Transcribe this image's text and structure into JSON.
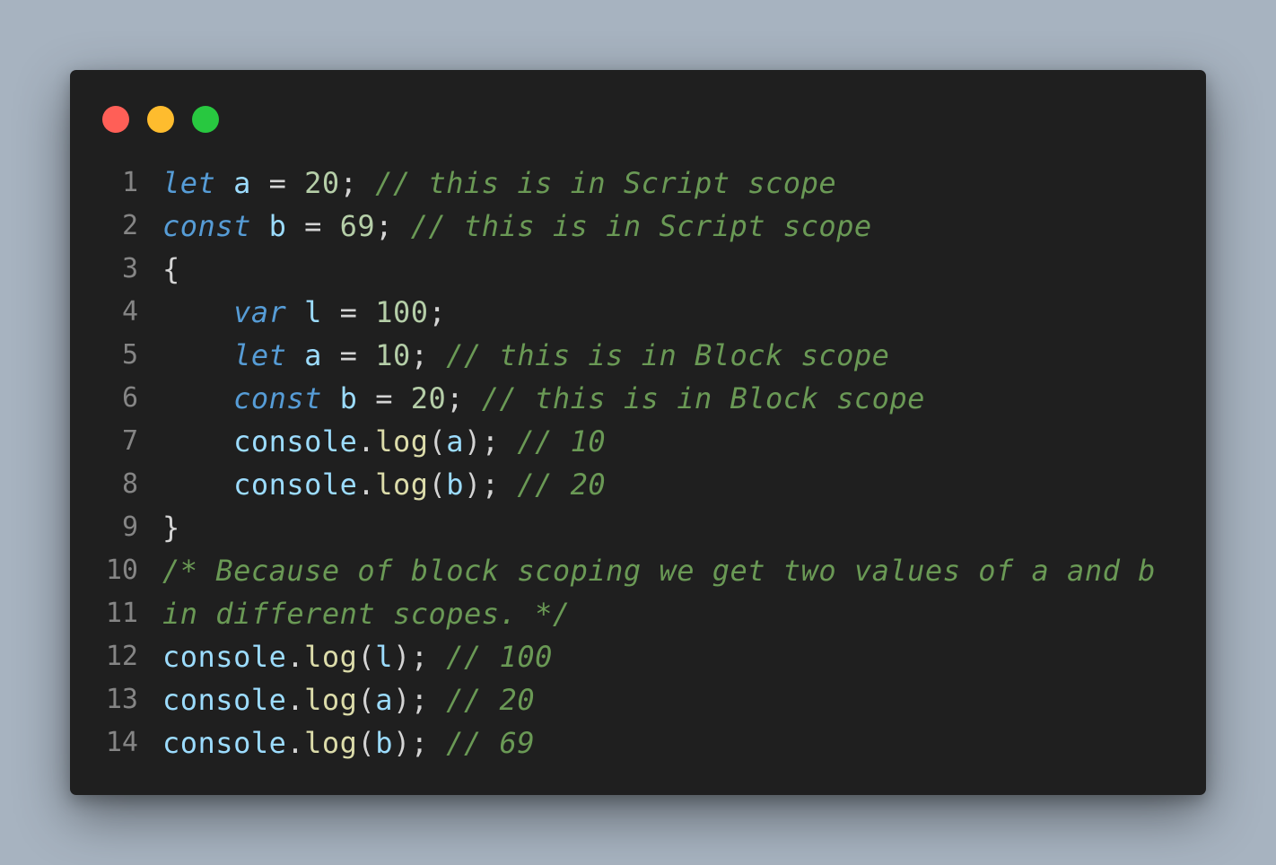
{
  "colors": {
    "page_background": "#a7b3c0",
    "editor_background": "#1f1f1f",
    "close": "#ff5f57",
    "minimize": "#febc2e",
    "maximize": "#28c840",
    "line_number": "#858585",
    "keyword": "#569cd6",
    "variable": "#9cdcfe",
    "number": "#b5cea8",
    "function": "#dcdcaa",
    "comment": "#6a9955",
    "plain": "#d4d4d4"
  },
  "window_controls": [
    {
      "name": "close-button",
      "icon": "red-circle"
    },
    {
      "name": "minimize-button",
      "icon": "yellow-circle"
    },
    {
      "name": "maximize-button",
      "icon": "green-circle"
    }
  ],
  "code_lines": [
    {
      "number": "1",
      "indent": "",
      "tokens": [
        {
          "t": "let",
          "k": "kw"
        },
        {
          "t": " ",
          "k": "p"
        },
        {
          "t": "a",
          "k": "var"
        },
        {
          "t": " = ",
          "k": "p"
        },
        {
          "t": "20",
          "k": "num"
        },
        {
          "t": "; ",
          "k": "p"
        },
        {
          "t": "// this is in Script scope",
          "k": "com"
        }
      ]
    },
    {
      "number": "2",
      "indent": "",
      "tokens": [
        {
          "t": "const",
          "k": "kw"
        },
        {
          "t": " ",
          "k": "p"
        },
        {
          "t": "b",
          "k": "var"
        },
        {
          "t": " = ",
          "k": "p"
        },
        {
          "t": "69",
          "k": "num"
        },
        {
          "t": "; ",
          "k": "p"
        },
        {
          "t": "// this is in Script scope",
          "k": "com"
        }
      ]
    },
    {
      "number": "3",
      "indent": "",
      "tokens": [
        {
          "t": "{",
          "k": "p"
        }
      ]
    },
    {
      "number": "4",
      "indent": "    ",
      "tokens": [
        {
          "t": "var",
          "k": "kw"
        },
        {
          "t": " ",
          "k": "p"
        },
        {
          "t": "l",
          "k": "var"
        },
        {
          "t": " = ",
          "k": "p"
        },
        {
          "t": "100",
          "k": "num"
        },
        {
          "t": ";",
          "k": "p"
        }
      ]
    },
    {
      "number": "5",
      "indent": "    ",
      "tokens": [
        {
          "t": "let",
          "k": "kw"
        },
        {
          "t": " ",
          "k": "p"
        },
        {
          "t": "a",
          "k": "var"
        },
        {
          "t": " = ",
          "k": "p"
        },
        {
          "t": "10",
          "k": "num"
        },
        {
          "t": "; ",
          "k": "p"
        },
        {
          "t": "// this is in Block scope",
          "k": "com"
        }
      ]
    },
    {
      "number": "6",
      "indent": "    ",
      "tokens": [
        {
          "t": "const",
          "k": "kw"
        },
        {
          "t": " ",
          "k": "p"
        },
        {
          "t": "b",
          "k": "var"
        },
        {
          "t": " = ",
          "k": "p"
        },
        {
          "t": "20",
          "k": "num"
        },
        {
          "t": "; ",
          "k": "p"
        },
        {
          "t": "// this is in Block scope",
          "k": "com"
        }
      ]
    },
    {
      "number": "7",
      "indent": "    ",
      "tokens": [
        {
          "t": "console",
          "k": "var"
        },
        {
          "t": ".",
          "k": "p"
        },
        {
          "t": "log",
          "k": "fn"
        },
        {
          "t": "(",
          "k": "p"
        },
        {
          "t": "a",
          "k": "var"
        },
        {
          "t": "); ",
          "k": "p"
        },
        {
          "t": "// 10",
          "k": "com"
        }
      ]
    },
    {
      "number": "8",
      "indent": "    ",
      "tokens": [
        {
          "t": "console",
          "k": "var"
        },
        {
          "t": ".",
          "k": "p"
        },
        {
          "t": "log",
          "k": "fn"
        },
        {
          "t": "(",
          "k": "p"
        },
        {
          "t": "b",
          "k": "var"
        },
        {
          "t": "); ",
          "k": "p"
        },
        {
          "t": "// 20",
          "k": "com"
        }
      ]
    },
    {
      "number": "9",
      "indent": "",
      "tokens": [
        {
          "t": "}",
          "k": "p"
        }
      ]
    },
    {
      "number": "10",
      "indent": "",
      "tokens": [
        {
          "t": "/* Because of block scoping we get two values of a and b",
          "k": "com"
        }
      ]
    },
    {
      "number": "11",
      "indent": "",
      "tokens": [
        {
          "t": "in different scopes. */",
          "k": "com"
        }
      ]
    },
    {
      "number": "12",
      "indent": "",
      "tokens": [
        {
          "t": "console",
          "k": "var"
        },
        {
          "t": ".",
          "k": "p"
        },
        {
          "t": "log",
          "k": "fn"
        },
        {
          "t": "(",
          "k": "p"
        },
        {
          "t": "l",
          "k": "var"
        },
        {
          "t": "); ",
          "k": "p"
        },
        {
          "t": "// 100",
          "k": "com"
        }
      ]
    },
    {
      "number": "13",
      "indent": "",
      "tokens": [
        {
          "t": "console",
          "k": "var"
        },
        {
          "t": ".",
          "k": "p"
        },
        {
          "t": "log",
          "k": "fn"
        },
        {
          "t": "(",
          "k": "p"
        },
        {
          "t": "a",
          "k": "var"
        },
        {
          "t": "); ",
          "k": "p"
        },
        {
          "t": "// 20",
          "k": "com"
        }
      ]
    },
    {
      "number": "14",
      "indent": "",
      "tokens": [
        {
          "t": "console",
          "k": "var"
        },
        {
          "t": ".",
          "k": "p"
        },
        {
          "t": "log",
          "k": "fn"
        },
        {
          "t": "(",
          "k": "p"
        },
        {
          "t": "b",
          "k": "var"
        },
        {
          "t": "); ",
          "k": "p"
        },
        {
          "t": "// 69",
          "k": "com"
        }
      ]
    }
  ]
}
